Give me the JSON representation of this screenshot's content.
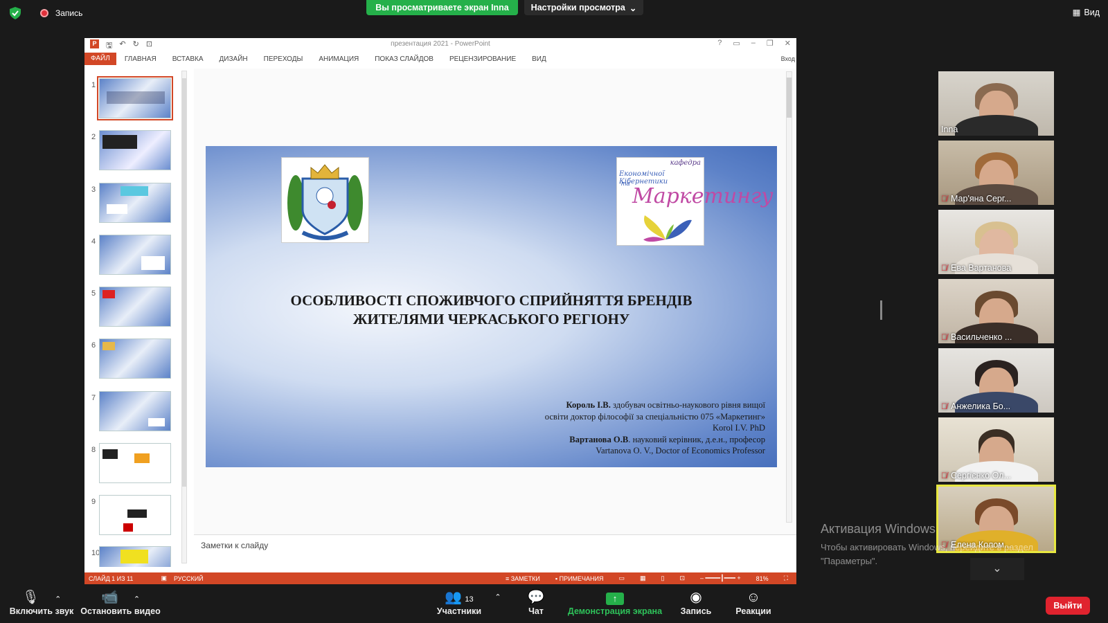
{
  "zoom_bar": {
    "recording_label": "Запись",
    "viewing_banner": "Вы просматриваете экран Inna",
    "view_options": "Настройки просмотра",
    "view_label": "Вид"
  },
  "powerpoint": {
    "window_title": "презентация 2021 - PowerPoint",
    "tabs": [
      "ФАЙЛ",
      "ГЛАВНАЯ",
      "ВСТАВКА",
      "ДИЗАЙН",
      "ПЕРЕХОДЫ",
      "АНИМАЦИЯ",
      "ПОКАЗ СЛАЙДОВ",
      "РЕЦЕНЗИРОВАНИЕ",
      "ВИД"
    ],
    "login": "Вход",
    "thumbnails": [
      "1",
      "2",
      "3",
      "4",
      "5",
      "6",
      "7",
      "8",
      "9",
      "10"
    ],
    "slide": {
      "title_line1": "ОСОБЛИВОСТІ СПОЖИВЧОГО СПРИЙНЯТТЯ БРЕНДІВ",
      "title_line2": "ЖИТЕЛЯМИ ЧЕРКАСЬКОГО РЕГІОНУ",
      "logo_kafedra": "кафедра",
      "logo_line1": "Економічної Кібернетики",
      "logo_line2": "та",
      "logo_line3": "Маркетингу",
      "author1_name": "Король І.В.",
      "author1_desc": " здобувач освітньо-наукового рівня вищої",
      "author1_line2": "освіти доктор філософії за спеціальністю 075 «Маркетинг»",
      "author1_en": "Korol I.V. PhD",
      "author2_name": "Вартанова О.В",
      "author2_desc": ". науковий керівник, д.е.н., професор",
      "author2_en": "Vartanova O. V., Doctor of Economics Professor"
    },
    "notes_placeholder": "Заметки к слайду",
    "status": {
      "slide_info": "СЛАЙД 1 ИЗ 11",
      "language": "РУССКИЙ",
      "notes": "ЗАМЕТКИ",
      "comments": "ПРИМЕЧАНИЯ",
      "zoom": "81%"
    }
  },
  "participants": [
    {
      "name": "Inna",
      "muted": false
    },
    {
      "name": "Мар'яна Серг...",
      "muted": true
    },
    {
      "name": "Ева Вартанова",
      "muted": true
    },
    {
      "name": "Васильченко ...",
      "muted": true
    },
    {
      "name": "Анжелика Бо...",
      "muted": true
    },
    {
      "name": "Сергієнко Ол...",
      "muted": true
    },
    {
      "name": "Елена Колом...",
      "muted": true
    }
  ],
  "windows_activation": {
    "title": "Активация Windows",
    "line1": "Чтобы активировать Windows, перейдите в раздел",
    "line2": "\"Параметры\"."
  },
  "toolbar": {
    "unmute": "Включить звук",
    "stop_video": "Остановить видео",
    "participants": "Участники",
    "participants_count": "13",
    "chat": "Чат",
    "share": "Демонстрация экрана",
    "record": "Запись",
    "reactions": "Реакции",
    "exit": "Выйти"
  },
  "colors": {
    "ppt_accent": "#d24726",
    "zoom_green": "#25b04a",
    "exit_red": "#e0232e"
  }
}
